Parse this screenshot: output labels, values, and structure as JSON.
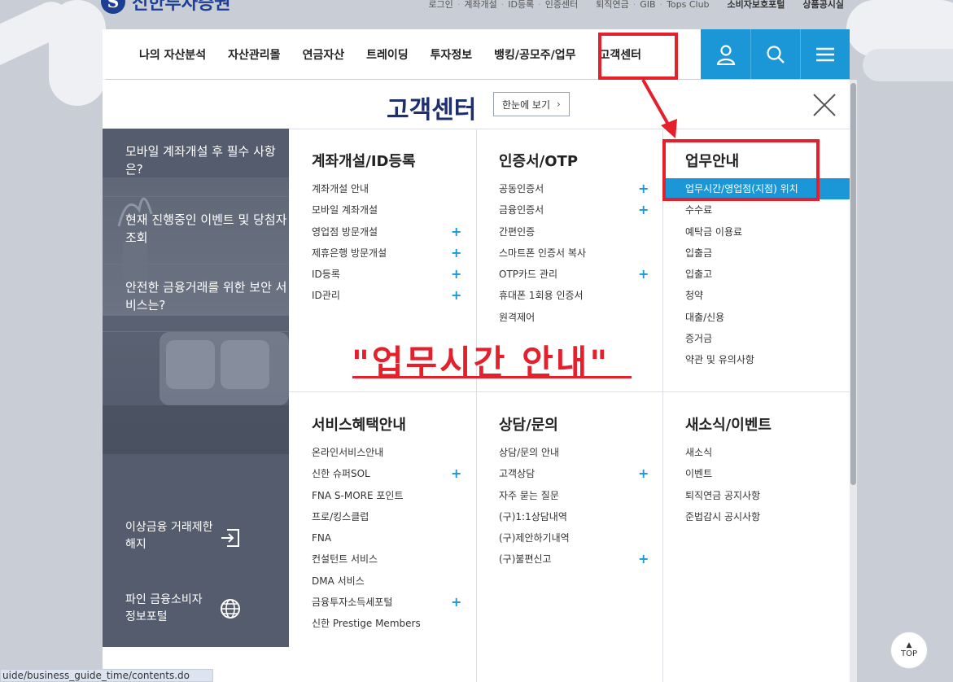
{
  "brand": {
    "name": "신한투자증권",
    "mark": "S"
  },
  "utility_links": [
    "로그인",
    "계좌개설",
    "ID등록",
    "인증센터",
    "퇴직연금",
    "GIB",
    "Tops Club",
    "소비자보호포털",
    "상품공시실"
  ],
  "nav": {
    "items": [
      "나의 자산분석",
      "자산관리몰",
      "연금자산",
      "트레이딩",
      "투자정보",
      "뱅킹/공모주/업무",
      "고객센터"
    ],
    "icons": [
      "user-icon",
      "search-icon",
      "menu-icon"
    ]
  },
  "panel": {
    "title": "고객센터",
    "view_all": "한눈에 보기",
    "side_items": [
      "모바일 계좌개설 후 필수 사항은?",
      "현재 진행중인 이벤트 및 당첨자 조회",
      "안전한 금융거래를 위한 보안 서비스는?"
    ],
    "side_links": [
      {
        "label": "이상금융 거래제한 해지",
        "icon": "exit-icon"
      },
      {
        "label": "파인 금융소비자 정보포털",
        "icon": "globe-icon"
      }
    ],
    "columns": [
      {
        "title": "계좌개설/ID등록",
        "items": [
          {
            "label": "계좌개설 안내",
            "plus": false
          },
          {
            "label": "모바일 계좌개설",
            "plus": false
          },
          {
            "label": "영업점 방문개설",
            "plus": true
          },
          {
            "label": "제휴은행 방문개설",
            "plus": true
          },
          {
            "label": "ID등록",
            "plus": true
          },
          {
            "label": "ID관리",
            "plus": true
          }
        ]
      },
      {
        "title": "인증서/OTP",
        "items": [
          {
            "label": "공동인증서",
            "plus": true
          },
          {
            "label": "금융인증서",
            "plus": true
          },
          {
            "label": "간편인증",
            "plus": false
          },
          {
            "label": "스마트폰 인증서 복사",
            "plus": false
          },
          {
            "label": "OTP카드 관리",
            "plus": true
          },
          {
            "label": "휴대폰 1회용 인증서",
            "plus": false
          },
          {
            "label": "원격제어",
            "plus": false
          }
        ]
      },
      {
        "title": "업무안내",
        "items": [
          {
            "label": "업무시간/영업점(지점) 위치",
            "plus": false,
            "selected": true
          },
          {
            "label": "수수료",
            "plus": false
          },
          {
            "label": "예탁금 이용료",
            "plus": false
          },
          {
            "label": "입출금",
            "plus": false
          },
          {
            "label": "입출고",
            "plus": false
          },
          {
            "label": "청약",
            "plus": false
          },
          {
            "label": "대출/신용",
            "plus": false
          },
          {
            "label": "증거금",
            "plus": false
          },
          {
            "label": "약관 및 유의사항",
            "plus": false
          }
        ]
      },
      {
        "title": "서비스혜택안내",
        "items": [
          {
            "label": "온라인서비스안내",
            "plus": false
          },
          {
            "label": "신한 슈퍼SOL",
            "plus": true
          },
          {
            "label": "FNA S-MORE 포인트",
            "plus": false
          },
          {
            "label": "프로/킹스클럽",
            "plus": false
          },
          {
            "label": "FNA",
            "plus": false
          },
          {
            "label": "컨설턴트 서비스",
            "plus": false
          },
          {
            "label": "DMA 서비스",
            "plus": false
          },
          {
            "label": "금융투자소득세포털",
            "plus": true
          },
          {
            "label": "신한 Prestige Members",
            "plus": false
          }
        ]
      },
      {
        "title": "상담/문의",
        "items": [
          {
            "label": "상담/문의 안내",
            "plus": false
          },
          {
            "label": "고객상담",
            "plus": true
          },
          {
            "label": "자주 묻는 질문",
            "plus": false
          },
          {
            "label": "(구)1:1상담내역",
            "plus": false
          },
          {
            "label": "(구)제안하기내역",
            "plus": false
          },
          {
            "label": "(구)불편신고",
            "plus": true
          }
        ]
      },
      {
        "title": "새소식/이벤트",
        "items": [
          {
            "label": "새소식",
            "plus": false
          },
          {
            "label": "이벤트",
            "plus": false
          },
          {
            "label": "퇴직연금 공지사항",
            "plus": false
          },
          {
            "label": "준법감시 공시사항",
            "plus": false
          }
        ]
      }
    ]
  },
  "annotation": {
    "text": "\"업무시간 안내\"",
    "color": "#e3202b"
  },
  "status_url": "uide/business_guide_time/contents.do",
  "top_button": "TOP",
  "colors": {
    "accent": "#1b96d6",
    "brand": "#1d3f93",
    "sidebar": "#545c6d",
    "annotation": "#e3202b"
  }
}
